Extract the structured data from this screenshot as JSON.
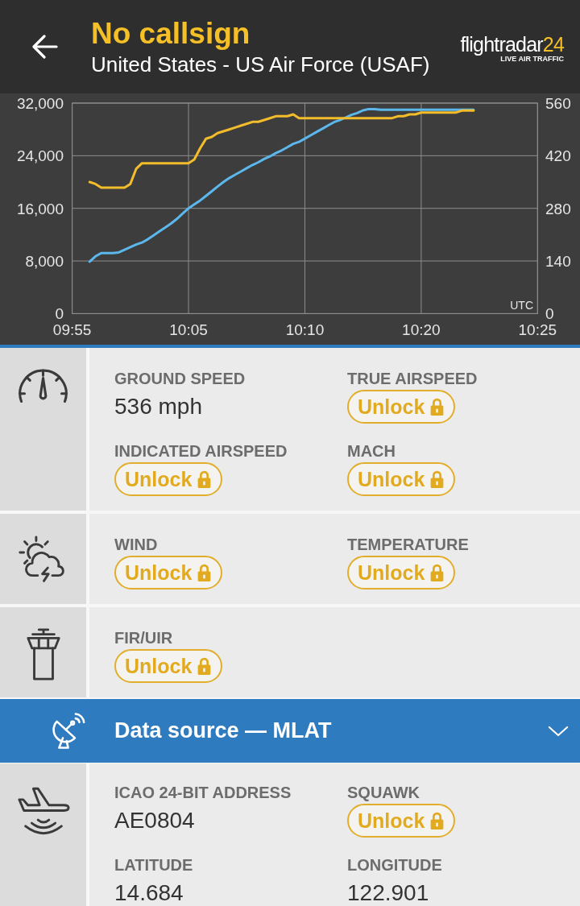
{
  "header": {
    "title": "No callsign",
    "subtitle": "United States - US Air Force (USAF)",
    "logo": {
      "wordmark": "flightradar",
      "wordmark_accent": "24",
      "tagline": "LIVE AIR TRAFFIC"
    }
  },
  "chart": {
    "corner_label": "UTC",
    "chart_data": {
      "type": "line",
      "grid": true,
      "categories": [
        "09:55",
        null,
        null,
        null,
        null,
        null,
        null,
        null,
        null,
        null,
        null,
        null,
        null,
        null,
        null,
        null,
        null,
        null,
        null,
        null,
        "10:05",
        null,
        null,
        null,
        null,
        null,
        null,
        null,
        null,
        null,
        null,
        null,
        null,
        null,
        null,
        null,
        null,
        null,
        null,
        null,
        "10:10",
        null,
        null,
        null,
        null,
        null,
        null,
        null,
        null,
        null,
        null,
        null,
        null,
        null,
        null,
        null,
        null,
        null,
        null,
        null,
        "10:20",
        null,
        null,
        null,
        null,
        null,
        null,
        null,
        null,
        null,
        null,
        null,
        null,
        null,
        null,
        null,
        null,
        null,
        null,
        null,
        "10:25"
      ],
      "ylim": [
        0,
        32000
      ],
      "yticks": [
        0,
        {
          "value": 8000,
          "label": "8,000"
        },
        {
          "value": 16000,
          "label": "16,000"
        },
        {
          "value": 24000,
          "label": "24,000"
        },
        {
          "value": 32000,
          "label": "32,000"
        }
      ],
      "y2lim": [
        0,
        560
      ],
      "y2ticks": [
        0,
        140,
        280,
        420,
        560
      ],
      "series": [
        {
          "color": "#5cb8ec",
          "values": [
            null,
            null,
            null,
            7900,
            8700,
            9200,
            9200,
            9200,
            9300,
            9700,
            10100,
            10500,
            10800,
            11300,
            11900,
            12500,
            13100,
            13700,
            14400,
            15200,
            16000,
            16600,
            17200,
            17900,
            18600,
            19300,
            20000,
            20600,
            21100,
            21600,
            22100,
            22600,
            23000,
            23500,
            23900,
            24400,
            24800,
            25300,
            25800,
            26100,
            26600,
            27100,
            27600,
            28100,
            28600,
            29100,
            29400,
            29800,
            30200,
            30500,
            30900,
            31100,
            31100,
            31000,
            31000,
            31000,
            31000,
            31000,
            31000,
            31000,
            31000,
            31000,
            31000,
            31000,
            31000,
            31000,
            31000,
            31000,
            31000,
            31000,
            null,
            null,
            null,
            null,
            null,
            null,
            null,
            null,
            null,
            null,
            null
          ]
        },
        {
          "color": "#f3bc2a",
          "axis": "y2",
          "values": [
            null,
            null,
            null,
            350,
            345,
            335,
            335,
            335,
            335,
            335,
            345,
            385,
            400,
            400,
            400,
            400,
            400,
            400,
            400,
            400,
            400,
            410,
            440,
            465,
            470,
            480,
            485,
            490,
            495,
            500,
            505,
            510,
            510,
            515,
            520,
            525,
            525,
            525,
            530,
            520,
            520,
            520,
            520,
            520,
            520,
            520,
            520,
            520,
            520,
            520,
            520,
            520,
            520,
            520,
            520,
            520,
            525,
            525,
            530,
            530,
            535,
            535,
            535,
            535,
            535,
            535,
            535,
            540,
            540,
            540,
            null,
            null,
            null,
            null,
            null,
            null,
            null,
            null,
            null,
            null,
            null
          ]
        }
      ]
    }
  },
  "panels": [
    {
      "kind": "fields",
      "fields": [
        {
          "label": "GROUND SPEED",
          "kind": "value",
          "value": "536 mph"
        },
        {
          "label": "TRUE AIRSPEED",
          "kind": "locked",
          "button": "Unlock"
        },
        {
          "label": "INDICATED AIRSPEED",
          "kind": "locked",
          "button": "Unlock"
        },
        {
          "label": "MACH",
          "kind": "locked",
          "button": "Unlock"
        }
      ]
    },
    {
      "kind": "fields",
      "fields": [
        {
          "label": "WIND",
          "kind": "locked",
          "button": "Unlock"
        },
        {
          "label": "TEMPERATURE",
          "kind": "locked",
          "button": "Unlock"
        }
      ]
    },
    {
      "kind": "fields",
      "fields": [
        {
          "label": "FIR/UIR",
          "kind": "locked",
          "button": "Unlock"
        }
      ]
    },
    {
      "kind": "source_bar",
      "title": "Data source — MLAT"
    },
    {
      "kind": "fields",
      "fields": [
        {
          "label": "ICAO 24-BIT ADDRESS",
          "kind": "value",
          "value": "AE0804"
        },
        {
          "label": "SQUAWK",
          "kind": "locked",
          "button": "Unlock"
        },
        {
          "label": "LATITUDE",
          "kind": "value",
          "value": "14.684"
        },
        {
          "label": "LONGITUDE",
          "kind": "value",
          "value": "122.901"
        }
      ]
    }
  ]
}
